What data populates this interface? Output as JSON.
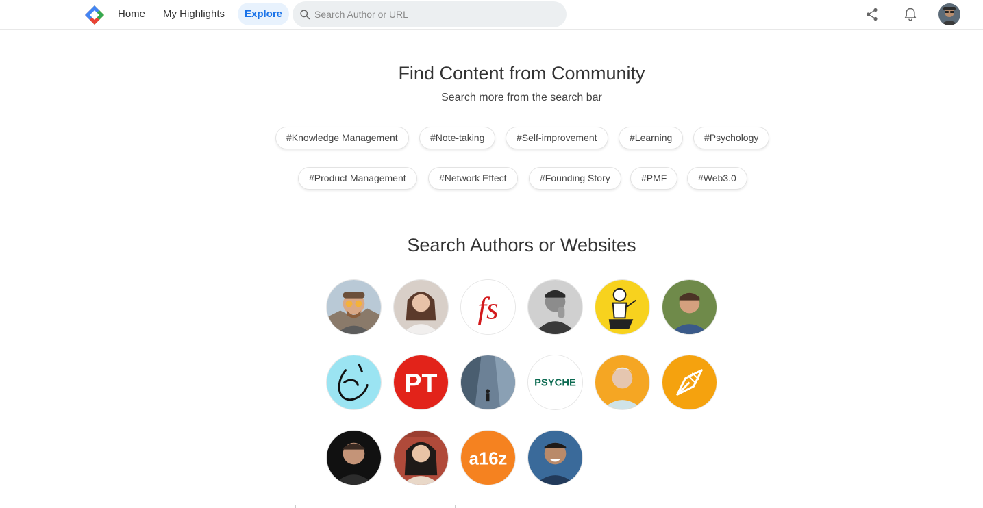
{
  "nav": {
    "home": "Home",
    "highlights": "My Highlights",
    "explore": "Explore"
  },
  "search": {
    "placeholder": "Search Author or URL"
  },
  "community": {
    "title": "Find Content from Community",
    "subtitle": "Search more from the search bar"
  },
  "tags": [
    "#Knowledge Management",
    "#Note-taking",
    "#Self-improvement",
    "#Learning",
    "#Psychology",
    "#Product Management",
    "#Network Effect",
    "#Founding Story",
    "#PMF",
    "#Web3.0"
  ],
  "authors_section": {
    "title": "Search Authors or Websites"
  },
  "authors": {
    "fs_logo": "fs",
    "pt_logo": "PT",
    "psyche_logo": "PSYCHE",
    "a16z_logo": "a16z"
  },
  "colors": {
    "accent": "#1a73e8",
    "explore_bg": "#e8f2fd",
    "search_bg": "#eceff1",
    "fs_red": "#d3191c",
    "pt_red": "#e2231a",
    "psyche_green": "#0d6b52",
    "a16z_orange": "#f58220",
    "yellow": "#f7d21e",
    "light_blue": "#9be4f2"
  }
}
